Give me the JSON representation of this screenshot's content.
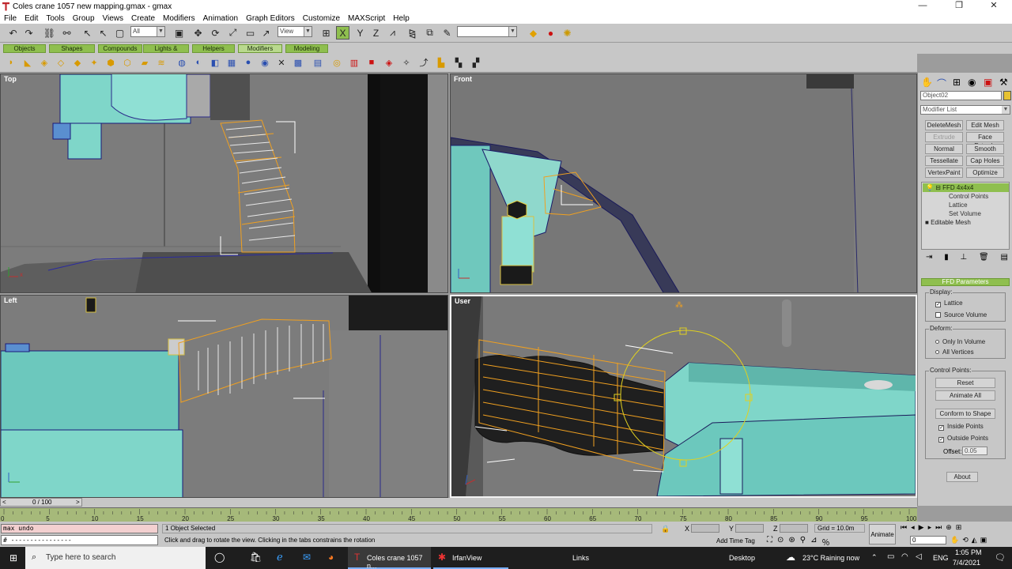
{
  "window": {
    "title": "Coles crane 1057 new mapping.gmax - gmax",
    "min": "—",
    "max": "❐",
    "close": "✕"
  },
  "menu": [
    "File",
    "Edit",
    "Tools",
    "Group",
    "Views",
    "Create",
    "Modifiers",
    "Animation",
    "Graph Editors",
    "Customize",
    "MAXScript",
    "Help"
  ],
  "toolbar": {
    "selection_filter": "All",
    "ref_coord": "View",
    "named_selection": ""
  },
  "tabs": [
    "Objects",
    "Shapes",
    "Compounds",
    "Lights & Cameras",
    "Helpers",
    "Modifiers",
    "Modeling"
  ],
  "active_tab": "Modifiers",
  "viewports": {
    "top": "Top",
    "front": "Front",
    "left": "Left",
    "user": "User"
  },
  "command_panel": {
    "object_name": "Object02",
    "object_color": "#e6c232",
    "modifier_list": "Modifier List",
    "buttons": [
      "DeleteMesh",
      "Edit Mesh",
      "Extrude",
      "Face Extrude",
      "Normal",
      "Smooth",
      "Tessellate",
      "Cap Holes",
      "VertexPaint",
      "Optimize"
    ],
    "disabled_button": "Extrude",
    "stack": [
      {
        "label": "FFD 4x4x4",
        "level": 0,
        "selected": true
      },
      {
        "label": "Control Points",
        "level": 1
      },
      {
        "label": "Lattice",
        "level": 1
      },
      {
        "label": "Set Volume",
        "level": 1
      },
      {
        "label": "Editable Mesh",
        "level": 0
      }
    ],
    "rollout_title": "FFD Parameters",
    "display_group": "Display:",
    "lattice": "Lattice",
    "lattice_checked": true,
    "source_volume": "Source Volume",
    "source_volume_checked": false,
    "deform_group": "Deform:",
    "only_in_volume": "Only In Volume",
    "all_vertices": "All Vertices",
    "control_points_group": "Control Points:",
    "reset": "Reset",
    "animate_all": "Animate All",
    "conform": "Conform to Shape",
    "inside_points": "Inside Points",
    "inside_checked": true,
    "outside_points": "Outside Points",
    "outside_checked": true,
    "offset_label": "Offset:",
    "offset_value": "0.05",
    "about": "About"
  },
  "timeline": {
    "frame_display": "0 / 100",
    "ticks": [
      "0",
      "5",
      "10",
      "15",
      "20",
      "25",
      "30",
      "35",
      "40",
      "45",
      "50",
      "55",
      "60",
      "65",
      "70",
      "75",
      "80",
      "85",
      "90",
      "95",
      "100"
    ]
  },
  "status": {
    "maxscript_line": "max undo",
    "maxscript_out": "# ----------------",
    "selection": "1 Object Selected",
    "prompt": "Click and drag to rotate the view. Clicking in the tabs constrains the rotation",
    "x_label": "X",
    "y_label": "Y",
    "z_label": "Z",
    "grid": "Grid = 10.0m",
    "add_time_tag": "Add Time Tag",
    "animate": "Animate",
    "frame": "0"
  },
  "taskbar": {
    "search": "Type here to search",
    "app1": "Coles crane 1057 n...",
    "app2": "IrfanView",
    "links": "Links",
    "desktop": "Desktop",
    "weather": "23°C  Raining now",
    "lang": "ENG",
    "time": "1:05 PM",
    "date": "7/4/2021"
  }
}
